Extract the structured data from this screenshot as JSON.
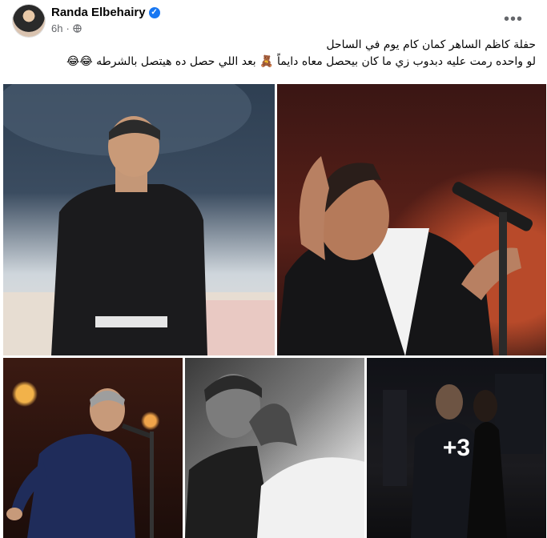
{
  "post": {
    "author": "Randa Elbehairy",
    "time": "6h",
    "dot": "·",
    "more_label": "•••",
    "caption_line1": "حفلة كاظم الساهر كمان كام يوم في الساحل",
    "caption_line2": "لو واحده رمت عليه دبدوب زي ما كان بيحصل معاه دايماً 🧸 بعد اللي حصل ده هيتصل بالشرطه 😂😂",
    "extra_photos": "+3",
    "photo_count": 5
  },
  "colors": {
    "verified": "#1877f2",
    "meta_text": "#65676b"
  },
  "icons": [
    "verified-badge-icon",
    "globe-icon",
    "more-options-icon"
  ]
}
